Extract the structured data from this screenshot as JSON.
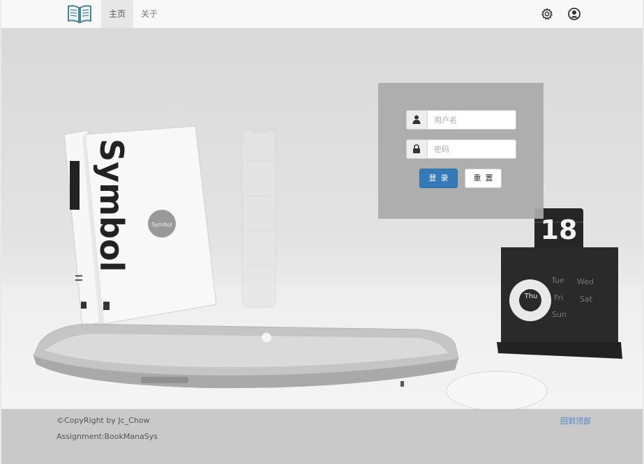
{
  "nav": {
    "logo_icon": "open-book-icon",
    "items": [
      {
        "label": "主页",
        "active": true
      },
      {
        "label": "关于",
        "active": false
      }
    ],
    "settings_icon": "gear-icon",
    "user_icon": "user-circle-icon"
  },
  "hero": {
    "book_spine_title": "Symbol",
    "book_sticker_text": "Symbol",
    "calendar_number": "18",
    "calendar_days": [
      "Tue",
      "Wed",
      "Thu",
      "Fri",
      "Sat",
      "Sun"
    ]
  },
  "login": {
    "username_placeholder": "用户名",
    "username_icon": "user-icon",
    "password_placeholder": "密码",
    "password_icon": "lock-icon",
    "login_label": "登录",
    "reset_label": "重置",
    "accent_color": "#337ab7"
  },
  "footer": {
    "copyright": "©CopyRight by Jc_Chow",
    "assignment": "Assignment:BookManaSys",
    "back_to_top": "回到顶部",
    "link_color": "#4a86c5"
  }
}
